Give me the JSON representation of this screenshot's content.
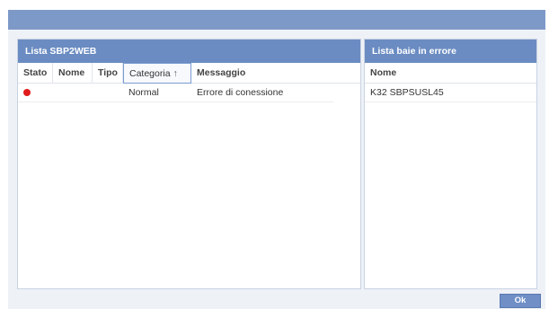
{
  "left_panel": {
    "title": "Lista SBP2WEB",
    "columns": [
      "Stato",
      "Nome",
      "Tipo",
      "Categoria",
      "Messaggio"
    ],
    "sort_arrow": "↑",
    "rows": [
      {
        "stato": "red",
        "nome": "",
        "tipo": "",
        "categoria": "Normal",
        "messaggio": "Errore di conessione"
      }
    ]
  },
  "right_panel": {
    "title": "Lista baie in errore",
    "columns": [
      "Nome"
    ],
    "rows": [
      {
        "nome": "K32 SBPSUSL45"
      }
    ]
  },
  "footer": {
    "ok_label": "Ok"
  },
  "colors": {
    "header_bg": "#6b8cc2",
    "titlebar_bg": "#7d99c7",
    "status_error": "#e11b1b"
  }
}
